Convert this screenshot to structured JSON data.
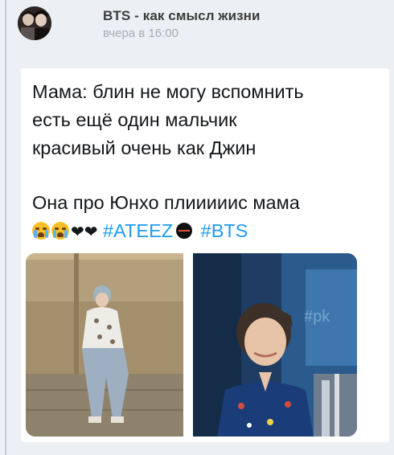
{
  "post": {
    "group_name": "BTS - как смысл жизни",
    "time": "вчера в 16:00"
  },
  "tweet": {
    "line1": "Мама: блин не могу вспомнить",
    "line2": "есть ещё один мальчик",
    "line3": "красивый очень  как Джин",
    "line4": "Она про Юнхо плииииис мама",
    "hearts": "❤❤",
    "hashtag1": "#ATEEZ",
    "hashtag2": "#BTS",
    "emoji": [
      "loudly-crying-face",
      "loudly-crying-face",
      "black-heart",
      "black-heart",
      "black-circle"
    ]
  },
  "images": {
    "left": "photo-man-sitting-on-wall",
    "right": "photo-man-smiling-blue-shirt",
    "right_watermark": "#pk"
  },
  "colors": {
    "hashtag": "#1d9bf0",
    "background": "#eceff3",
    "group_name": "#3c3c3c",
    "time": "#a7adb4"
  }
}
